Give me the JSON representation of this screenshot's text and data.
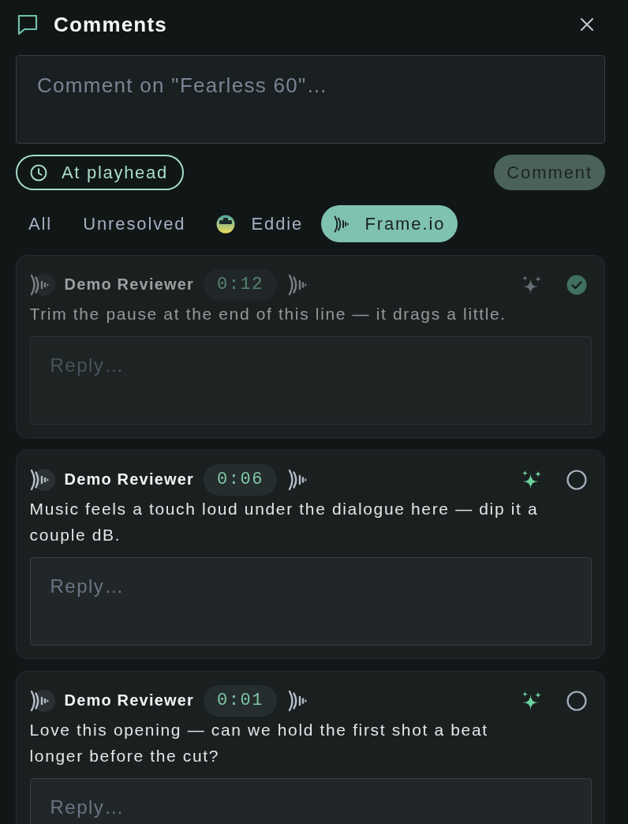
{
  "panel": {
    "title": "Comments"
  },
  "composer": {
    "placeholder": "Comment on \"Fearless 60\"…",
    "at_playhead": {
      "label": "At playhead"
    },
    "submit": {
      "label": "Comment",
      "disabled": true
    }
  },
  "filters": [
    {
      "label": "All",
      "kind": "text",
      "selected": false
    },
    {
      "label": "Unresolved",
      "kind": "text",
      "selected": false
    },
    {
      "label": "Eddie",
      "kind": "person",
      "selected": false
    },
    {
      "label": "Frame.io",
      "kind": "app",
      "selected": true
    }
  ],
  "comments": [
    {
      "author": "Demo Reviewer",
      "timestamp": "0:12",
      "text": "Trim the pause at the end of this line — it drags a little.",
      "resolved": true,
      "reply": {
        "placeholder": "Reply…"
      }
    },
    {
      "author": "Demo Reviewer",
      "timestamp": "0:06",
      "text": "Music feels a touch loud under the dialogue here — dip it a couple dB.",
      "resolved": false,
      "reply": {
        "placeholder": "Reply…"
      }
    },
    {
      "author": "Demo Reviewer",
      "timestamp": "0:01",
      "text": "Love this opening — can we hold the first shot a beat longer before the cut?",
      "resolved": false,
      "reply": {
        "placeholder": "Reply…"
      }
    }
  ]
}
